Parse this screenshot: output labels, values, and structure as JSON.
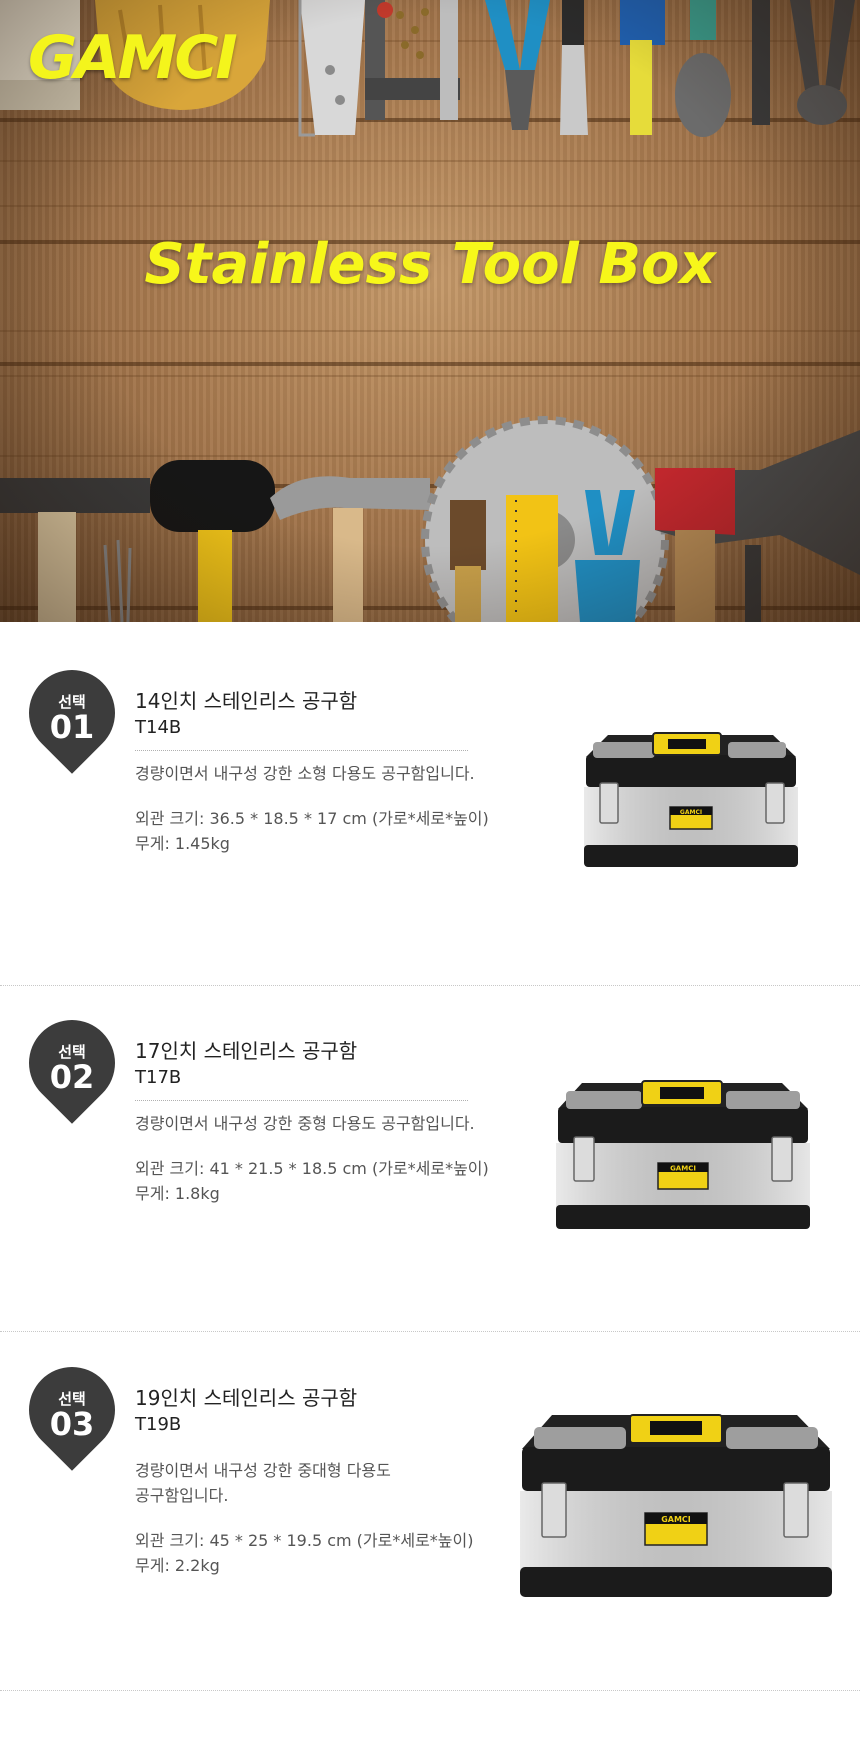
{
  "brand": {
    "logo_text": "GAMCI"
  },
  "hero": {
    "title": "Stainless Tool Box"
  },
  "colors": {
    "accent_yellow": "#f4f51c",
    "badge_dark": "#3c3c3c",
    "text_dark": "#222222",
    "text_gray": "#555555"
  },
  "products": [
    {
      "badge_label": "선택",
      "badge_number": "01",
      "title": "14인치 스테인리스 공구함",
      "model": "T14B",
      "description": "경량이면서 내구성 강한 소형 다용도 공구함입니다.",
      "size": "외관 크기: 36.5 * 18.5 * 17 cm (가로*세로*높이)",
      "weight": "무게: 1.45kg",
      "box_logo": "GAMCI"
    },
    {
      "badge_label": "선택",
      "badge_number": "02",
      "title": "17인치 스테인리스 공구함",
      "model": "T17B",
      "description": "경량이면서 내구성 강한 중형 다용도 공구함입니다.",
      "size": "외관 크기: 41 * 21.5 * 18.5 cm (가로*세로*높이)",
      "weight": "무게: 1.8kg",
      "box_logo": "GAMCI"
    },
    {
      "badge_label": "선택",
      "badge_number": "03",
      "title": "19인치 스테인리스 공구함",
      "model": "T19B",
      "description_line1": "경량이면서 내구성 강한 중대형 다용도",
      "description_line2": "공구함입니다.",
      "size": "외관 크기: 45 * 25 * 19.5 cm (가로*세로*높이)",
      "weight": "무게: 2.2kg",
      "box_logo": "GAMCI"
    }
  ]
}
